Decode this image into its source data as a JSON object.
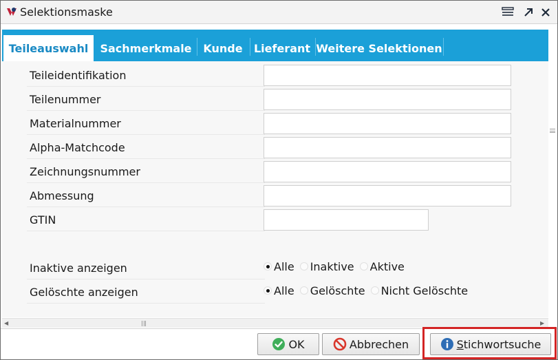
{
  "window": {
    "title": "Selektionsmaske"
  },
  "tabs": [
    {
      "label": "Teileauswahl",
      "active": true
    },
    {
      "label": "Sachmerkmale",
      "active": false
    },
    {
      "label": "Kunde",
      "active": false
    },
    {
      "label": "Lieferant",
      "active": false
    },
    {
      "label": "Weitere Selektionen",
      "active": false
    }
  ],
  "fields": [
    {
      "label": "Teileidentifikation",
      "value": ""
    },
    {
      "label": "Teilenummer",
      "value": ""
    },
    {
      "label": "Materialnummer",
      "value": ""
    },
    {
      "label": "Alpha-Matchcode",
      "value": ""
    },
    {
      "label": "Zeichnungsnummer",
      "value": ""
    },
    {
      "label": "Abmessung",
      "value": ""
    },
    {
      "label": "GTIN",
      "value": ""
    }
  ],
  "inaktive": {
    "label": "Inaktive anzeigen",
    "options": [
      "Alle",
      "Inaktive",
      "Aktive"
    ],
    "selected": "Alle"
  },
  "geloeschte": {
    "label": "Gelöschte anzeigen",
    "options": [
      "Alle",
      "Gelöschte",
      "Nicht Gelöschte"
    ],
    "selected": "Alle"
  },
  "buttons": {
    "ok": "OK",
    "cancel": "Abbrechen",
    "keyword_first": "S",
    "keyword_rest": "tichwortsuche"
  },
  "colors": {
    "tab_bar": "#1ba0d8",
    "active_tab_text": "#1a8ac4",
    "highlight": "#d32424"
  },
  "icons": {
    "app": "app-logo-icon",
    "menu": "menu-icon",
    "maximize": "maximize-arrow-icon",
    "close": "close-icon",
    "ok": "check-circle-icon",
    "cancel": "no-entry-icon",
    "keyword": "info-circle-icon"
  }
}
